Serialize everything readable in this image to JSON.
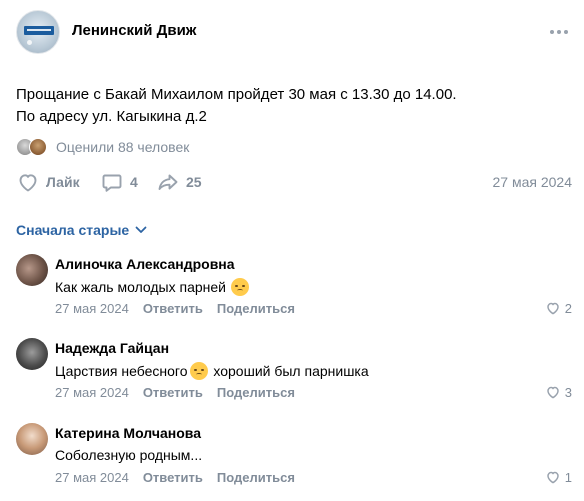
{
  "post": {
    "group_name": "Ленинский Движ",
    "text_lines": [
      "Прощание с Бакай Михаилом пройдет 30 мая с 13.30 до 14.00.",
      "По адресу ул. Кагыкина д.2"
    ],
    "likers_text": "Оценили 88 человек",
    "like_label": "Лайк",
    "comment_count": "4",
    "share_count": "25",
    "date": "27 мая 2024"
  },
  "comments_section": {
    "sort_label": "Сначала старые"
  },
  "comments": [
    {
      "author": "Алиночка Александровна",
      "text": "Как жаль молодых парней",
      "date": "27 мая 2024",
      "reply_label": "Ответить",
      "share_label": "Поделиться",
      "likes": "2"
    },
    {
      "author": "Надежда Гайцан",
      "text_before_emoji": "Царствия небесного",
      "text_after_emoji": " хороший был парнишка",
      "date": "27 мая 2024",
      "reply_label": "Ответить",
      "share_label": "Поделиться",
      "likes": "3"
    },
    {
      "author": "Катерина Молчанова",
      "text": "Соболезную родным...",
      "date": "27 мая 2024",
      "reply_label": "Ответить",
      "share_label": "Поделиться",
      "likes": "1"
    }
  ],
  "colors": {
    "muted": "#818c99",
    "link": "#2d64a3",
    "icon": "#99a2ad"
  },
  "icons": {
    "more": "more-horizontal-icon",
    "like": "heart-icon",
    "comment": "comment-bubble-icon",
    "share": "share-arrow-icon",
    "sort": "chevron-down-icon",
    "emoji": "sad-face-emoji-icon"
  }
}
